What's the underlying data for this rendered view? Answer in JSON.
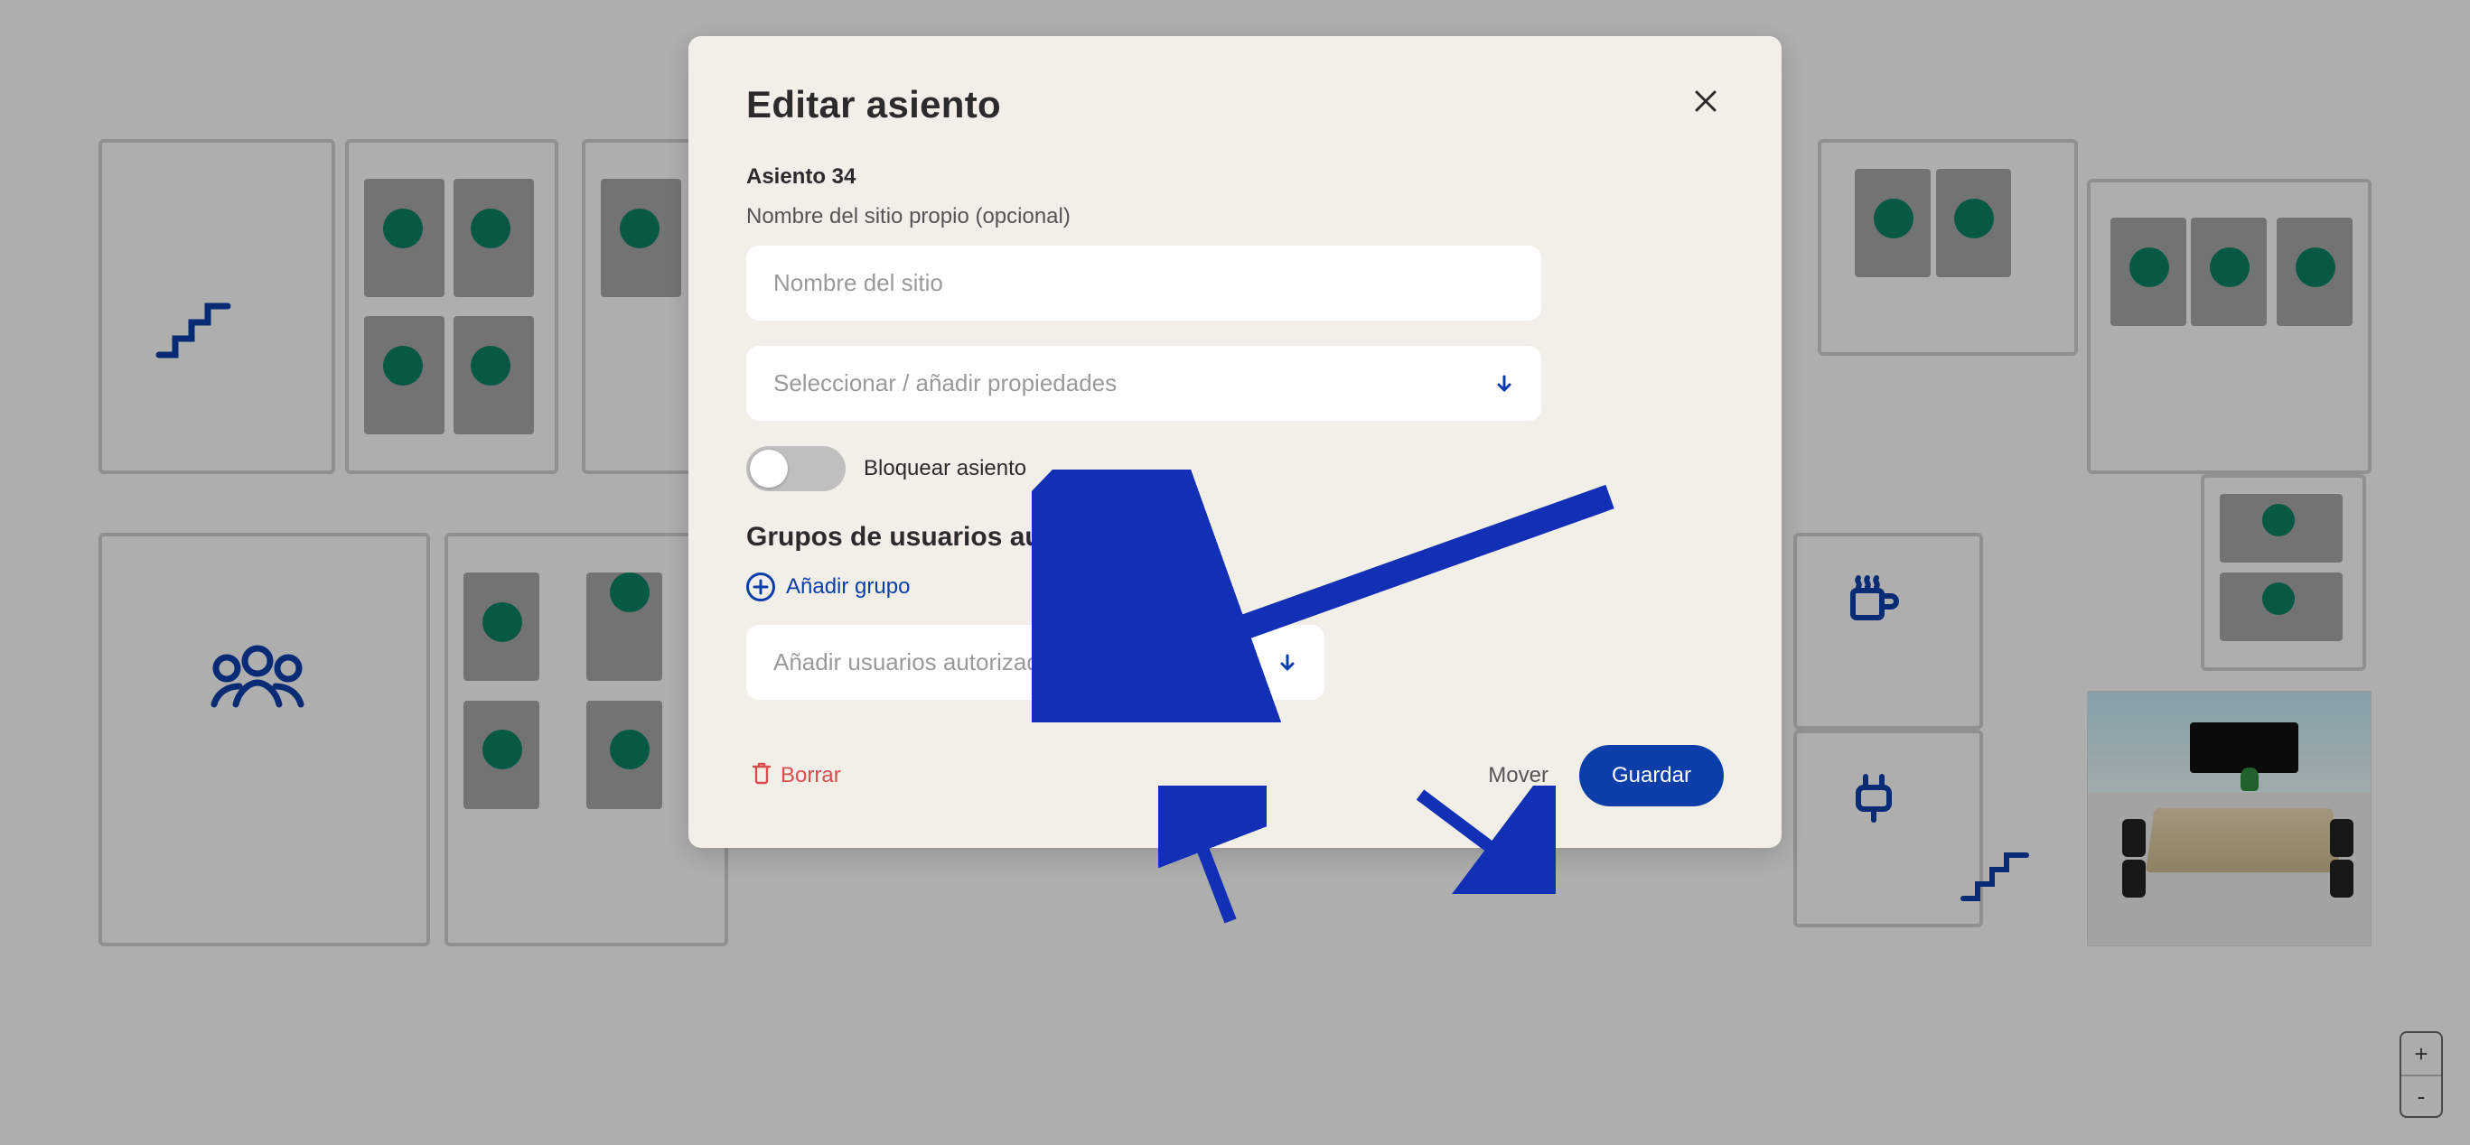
{
  "modal": {
    "title": "Editar asiento",
    "seat_id": "Asiento 34",
    "name_label": "Nombre del sitio propio (opcional)",
    "name_placeholder": "Nombre del sitio",
    "name_value": "",
    "properties_placeholder": "Seleccionar / añadir propiedades",
    "block_seat_label": "Bloquear asiento",
    "block_seat_value": false,
    "auth_groups_heading": "Grupos de usuarios autorizados",
    "add_group_label": "Añadir grupo",
    "auth_users_placeholder": "Añadir usuarios autorizados"
  },
  "actions": {
    "delete": "Borrar",
    "move": "Mover",
    "save": "Guardar"
  },
  "zoom": {
    "in": "+",
    "out": "-"
  },
  "colors": {
    "brand_blue": "#0b3ea8",
    "teal": "#0a7a5c",
    "danger": "#d94d4d"
  }
}
